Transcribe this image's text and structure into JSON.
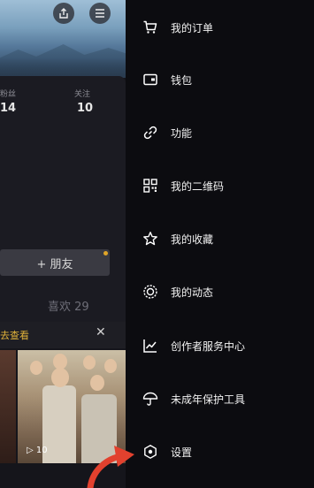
{
  "profile": {
    "stats": [
      {
        "label": "粉丝",
        "value": "14"
      },
      {
        "label": "关注",
        "value": "10"
      }
    ],
    "add_friend_label": "+ 朋友",
    "likes_label": "喜欢 29",
    "notice_text": "去查看",
    "video_play_count": "▷ 10"
  },
  "drawer": {
    "items": [
      {
        "label": "我的订单",
        "icon": "cart-icon"
      },
      {
        "label": "钱包",
        "icon": "wallet-icon"
      },
      {
        "label": "功能",
        "icon": "link-icon"
      },
      {
        "label": "我的二维码",
        "icon": "qrcode-icon"
      },
      {
        "label": "我的收藏",
        "icon": "star-icon"
      },
      {
        "label": "我的动态",
        "icon": "activity-icon"
      },
      {
        "label": "创作者服务中心",
        "icon": "chart-icon"
      },
      {
        "label": "未成年保护工具",
        "icon": "umbrella-icon"
      },
      {
        "label": "设置",
        "icon": "settings-icon"
      }
    ]
  },
  "colors": {
    "accent_orange": "#e0a528",
    "arrow_red": "#e2412e",
    "drawer_bg": "#0c0c10"
  }
}
